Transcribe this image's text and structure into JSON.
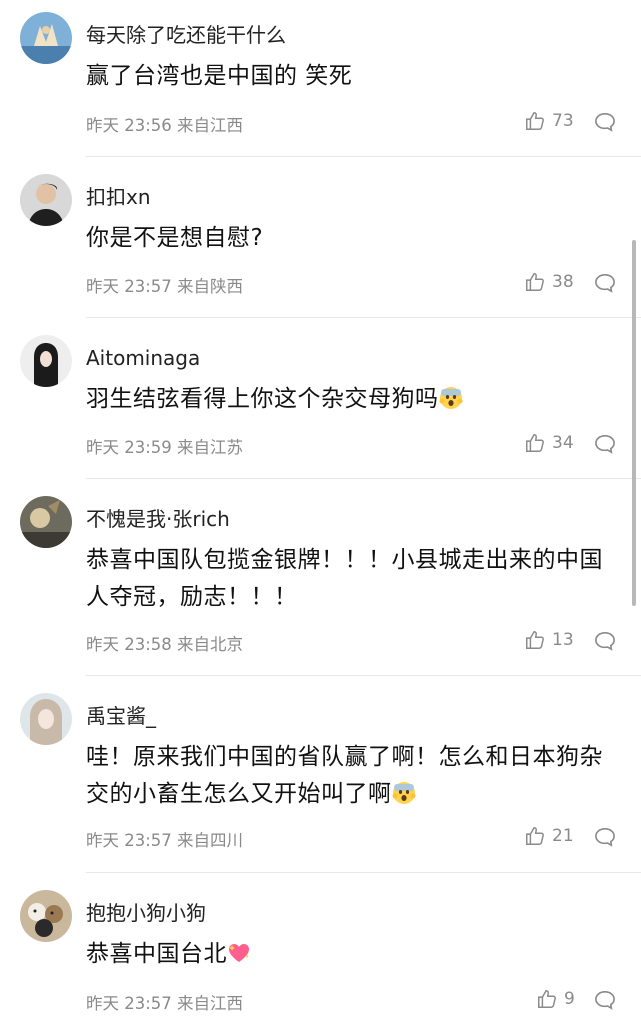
{
  "comments": [
    {
      "username": "每天除了吃还能干什么",
      "text": "赢了台湾也是中国的 笑死",
      "time": "昨天 23:56 来自江西",
      "likes": "73"
    },
    {
      "username": "扣扣xn",
      "text": "你是不是想自慰?",
      "time": "昨天 23:57 来自陕西",
      "likes": "38"
    },
    {
      "username": "Aitominaga",
      "text": "羽生结弦看得上你这个杂交母狗吗",
      "time": "昨天 23:59 来自江苏",
      "likes": "34"
    },
    {
      "username": "不愧是我·张rich",
      "text": "恭喜中国队包揽金银牌！！！小县城走出来的中国人夺冠，励志！！！",
      "time": "昨天 23:58 来自北京",
      "likes": "13"
    },
    {
      "username": "禹宝酱_",
      "text": "哇！原来我们中国的省队赢了啊！怎么和日本狗杂交的小畜生怎么又开始叫了啊",
      "time": "昨天 23:57 来自四川",
      "likes": "21"
    },
    {
      "username": "抱抱小狗小狗",
      "text": "恭喜中国台北",
      "time": "昨天 23:57 来自江西",
      "likes": "9"
    }
  ]
}
